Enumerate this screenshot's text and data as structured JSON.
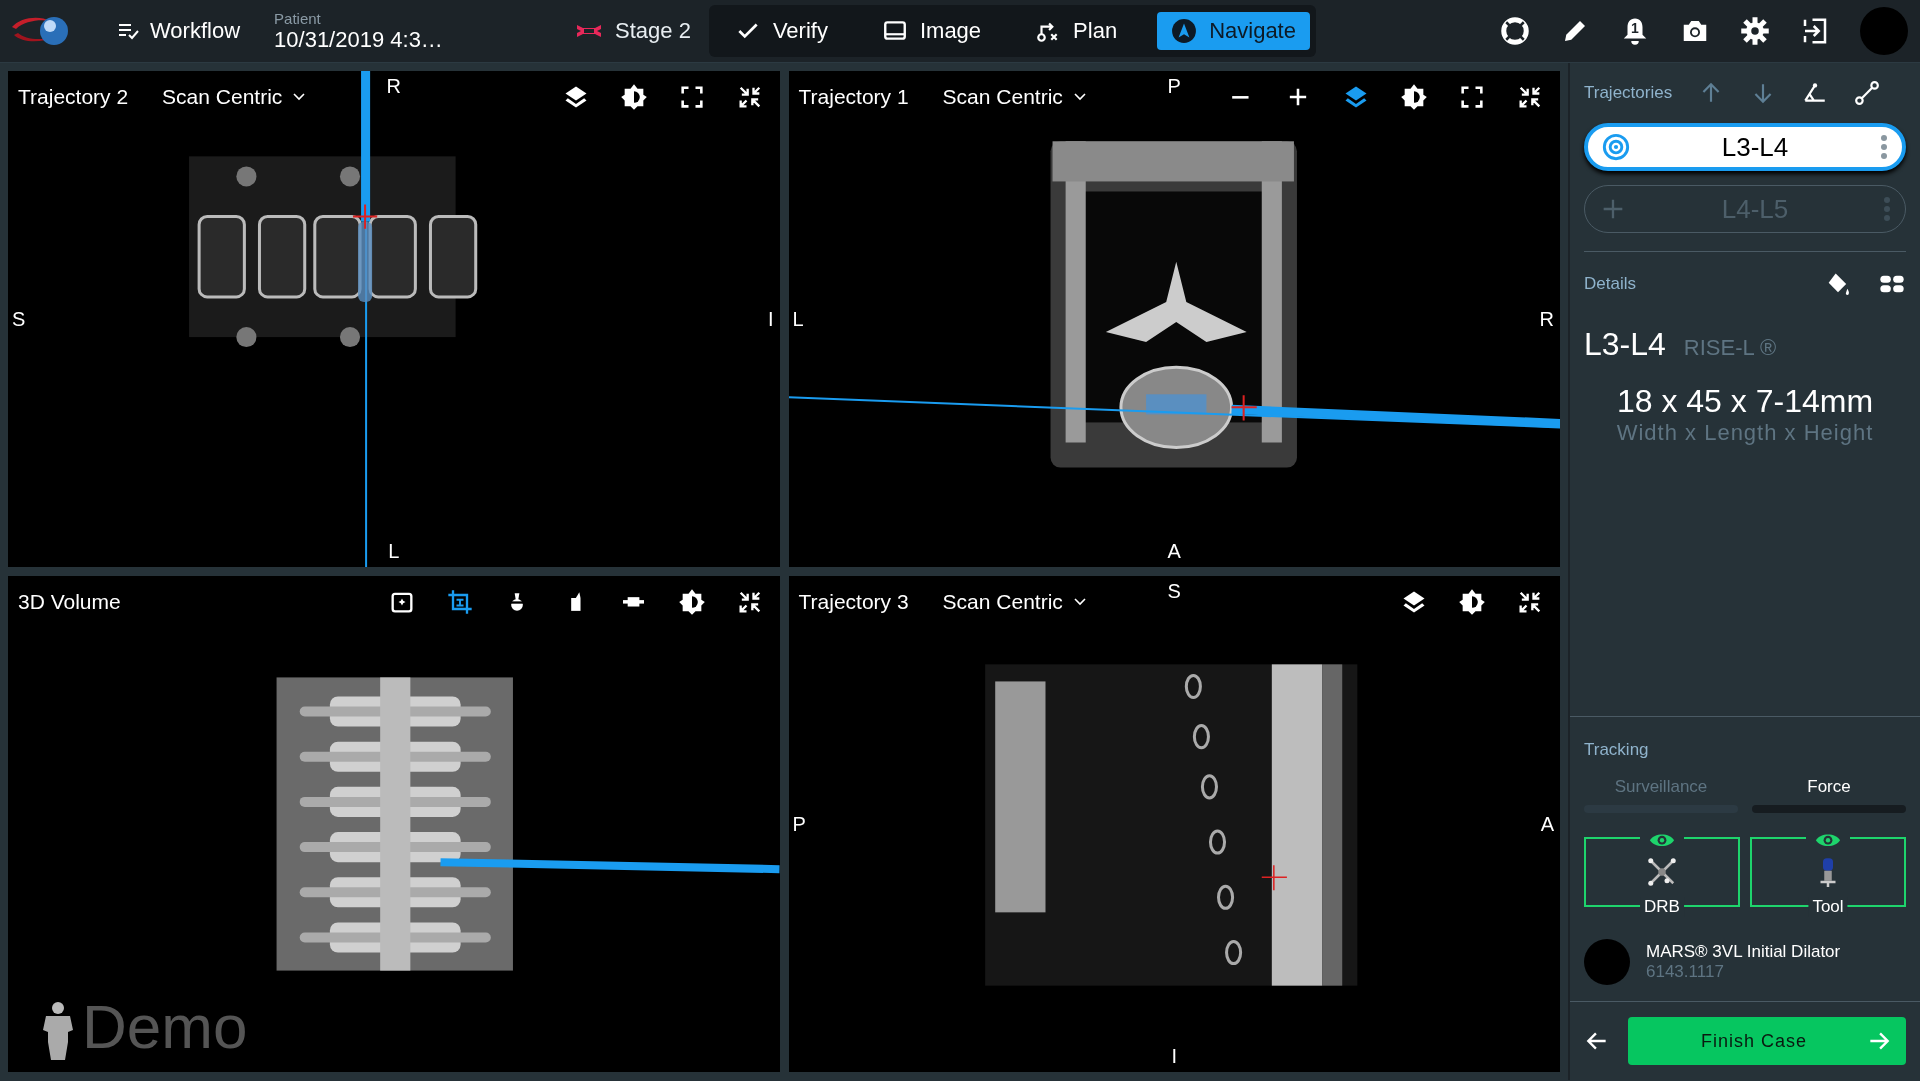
{
  "header": {
    "workflow": "Workflow",
    "patient_label": "Patient",
    "patient_value": "10/31/2019 4:3…",
    "stage": "Stage 2",
    "tabs": [
      {
        "kind": "verify",
        "label": "Verify",
        "selected": false
      },
      {
        "kind": "image",
        "label": "Image",
        "selected": false
      },
      {
        "kind": "plan",
        "label": "Plan",
        "selected": false
      },
      {
        "kind": "navigate",
        "label": "Navigate",
        "selected": true
      }
    ],
    "notifications": "1"
  },
  "viewports": [
    {
      "kind": "sagittal",
      "title": "Trajectory 2",
      "mode": "Scan Centric",
      "top": "R",
      "bottom": "L",
      "left": "S",
      "right": "I",
      "tools": [
        {
          "kind": "layers",
          "active": false
        },
        {
          "kind": "brightness",
          "active": false
        },
        {
          "kind": "fullscreen",
          "active": false
        },
        {
          "kind": "collapse",
          "active": false
        }
      ]
    },
    {
      "kind": "axial",
      "title": "Trajectory 1",
      "mode": "Scan Centric",
      "top": "P",
      "bottom": "A",
      "left": "L",
      "right": "R",
      "tools": [
        {
          "kind": "minus",
          "active": false
        },
        {
          "kind": "plus",
          "active": false
        },
        {
          "kind": "layers",
          "active": true
        },
        {
          "kind": "brightness",
          "active": false
        },
        {
          "kind": "fullscreen",
          "active": false
        },
        {
          "kind": "collapse",
          "active": false
        }
      ]
    },
    {
      "kind": "volume",
      "title": "3D Volume",
      "watermark": "Demo",
      "tools": [
        {
          "kind": "add_image",
          "active": false
        },
        {
          "kind": "crop",
          "active": true
        },
        {
          "kind": "view_top",
          "active": false
        },
        {
          "kind": "view_side",
          "active": false
        },
        {
          "kind": "view_front",
          "active": false
        },
        {
          "kind": "brightness",
          "active": false
        },
        {
          "kind": "collapse",
          "active": false
        }
      ]
    },
    {
      "kind": "coronal",
      "title": "Trajectory 3",
      "mode": "Scan Centric",
      "top": "S",
      "bottom": "I",
      "left": "P",
      "right": "A",
      "tools": [
        {
          "kind": "layers",
          "active": false
        },
        {
          "kind": "brightness",
          "active": false
        },
        {
          "kind": "collapse",
          "active": false
        }
      ]
    }
  ],
  "trajectories": {
    "title": "Trajectories",
    "items": [
      {
        "name": "L3-L4",
        "selected": true
      },
      {
        "name": "L4-L5",
        "selected": false
      }
    ]
  },
  "details": {
    "title": "Details",
    "level": "L3-L4",
    "implant": "RISE-L ®",
    "dimensions": "18 x 45 x 7-14mm",
    "dimensions_label": "Width x Length x Height"
  },
  "tracking": {
    "title": "Tracking",
    "modes": [
      {
        "label": "Surveillance",
        "selected": false
      },
      {
        "label": "Force",
        "selected": true
      }
    ],
    "markers": [
      {
        "kind": "drb",
        "label": "DRB",
        "visible": true
      },
      {
        "kind": "tool",
        "label": "Tool",
        "visible": true
      }
    ],
    "tool_name": "MARS® 3VL Initial Dilator",
    "tool_number": "6143.1117"
  },
  "footer": {
    "finish": "Finish Case"
  }
}
